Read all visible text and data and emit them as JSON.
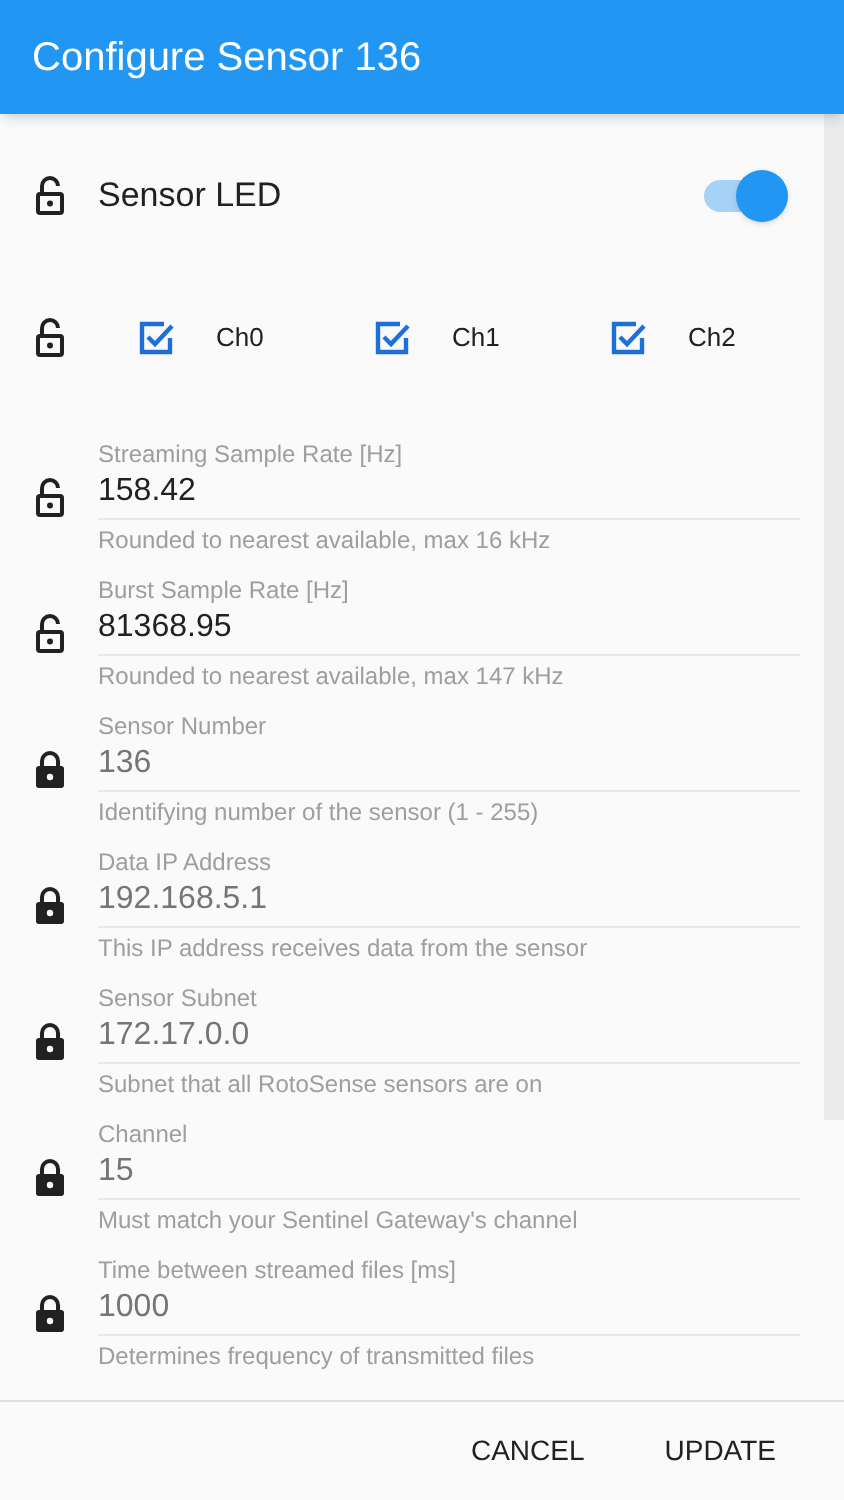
{
  "app_bar": {
    "title": "Configure Sensor 136"
  },
  "sensor_led": {
    "label": "Sensor LED",
    "locked": false,
    "on": true
  },
  "channels": {
    "locked": false,
    "items": [
      {
        "label": "Ch0",
        "checked": true
      },
      {
        "label": "Ch1",
        "checked": true
      },
      {
        "label": "Ch2",
        "checked": true
      }
    ]
  },
  "fields": [
    {
      "label": "Streaming Sample Rate [Hz]",
      "value": "158.42",
      "helper": "Rounded to nearest available, max 16 kHz",
      "locked": false
    },
    {
      "label": "Burst Sample Rate [Hz]",
      "value": "81368.95",
      "helper": "Rounded to nearest available, max 147 kHz",
      "locked": false
    },
    {
      "label": "Sensor Number",
      "value": "136",
      "helper": "Identifying number of the sensor (1 - 255)",
      "locked": true
    },
    {
      "label": "Data IP Address",
      "value": "192.168.5.1",
      "helper": "This IP address receives data from the sensor",
      "locked": true
    },
    {
      "label": "Sensor Subnet",
      "value": "172.17.0.0",
      "helper": "Subnet that all RotoSense sensors are on",
      "locked": true
    },
    {
      "label": "Channel",
      "value": "15",
      "helper": "Must match your Sentinel Gateway's channel",
      "locked": true
    },
    {
      "label": "Time between streamed files [ms]",
      "value": "1000",
      "helper": "Determines frequency of transmitted files",
      "locked": true
    }
  ],
  "buttons": [
    "CANCEL",
    "UPDATE"
  ]
}
